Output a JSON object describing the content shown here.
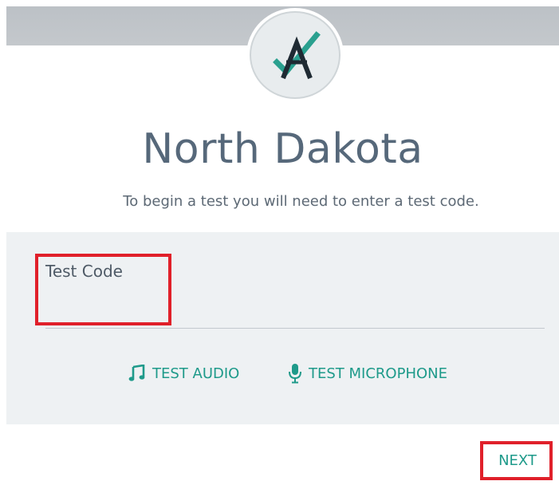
{
  "header": {
    "logo_icon": "a-check-logo-icon",
    "title": "North Dakota",
    "subtitle": "To begin a test you will need to enter a test code."
  },
  "code_form": {
    "label": "Test Code",
    "value": "",
    "placeholder": ""
  },
  "actions": {
    "test_audio": {
      "icon": "music-note-icon",
      "label": "TEST AUDIO"
    },
    "test_microphone": {
      "icon": "microphone-icon",
      "label": "TEST MICROPHONE"
    },
    "next": {
      "label": "NEXT"
    }
  },
  "colors": {
    "accent": "#1e9a8a",
    "title": "#56687a",
    "highlight": "#e0202a",
    "panel": "#eef1f3"
  }
}
